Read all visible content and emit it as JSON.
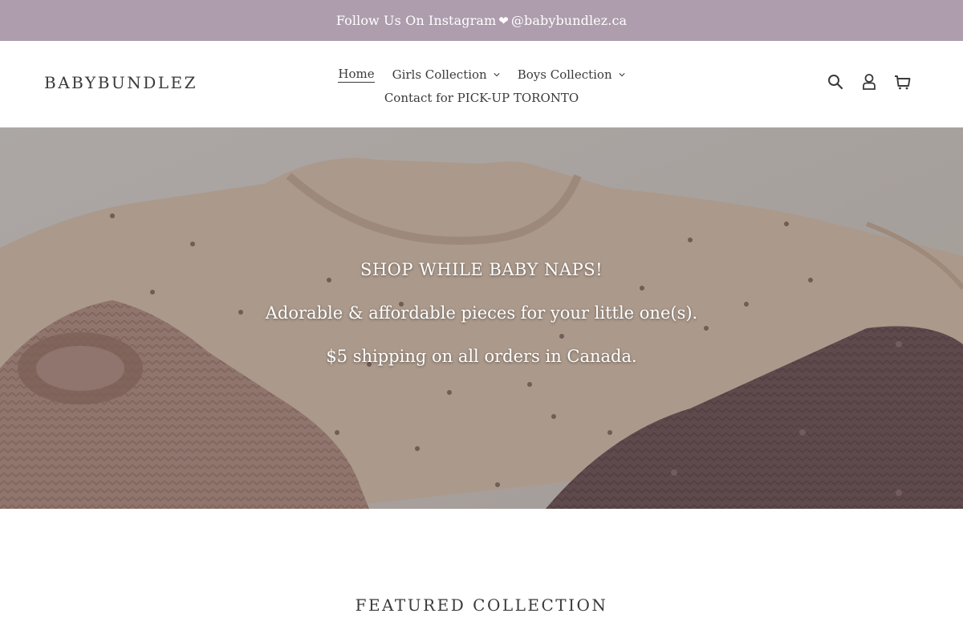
{
  "announcement": {
    "prefix": "Follow Us On Instagram",
    "heart": "❤",
    "handle": "@babybundlez.ca"
  },
  "header": {
    "logo": "BABYBUNDLEZ",
    "nav": {
      "home": "Home",
      "girls": "Girls Collection",
      "boys": "Boys Collection",
      "contact": "Contact for PICK-UP TORONTO"
    },
    "icons": [
      "search-icon",
      "account-icon",
      "cart-icon"
    ]
  },
  "hero": {
    "title": "SHOP WHILE BABY NAPS!",
    "line1": "Adorable & affordable pieces for your little one(s).",
    "line2": "$5 shipping on all orders in Canada."
  },
  "featured": {
    "title": "FEATURED COLLECTION"
  },
  "colors": {
    "announcement_bg": "#ad9dad",
    "text": "#3a3a3a"
  }
}
